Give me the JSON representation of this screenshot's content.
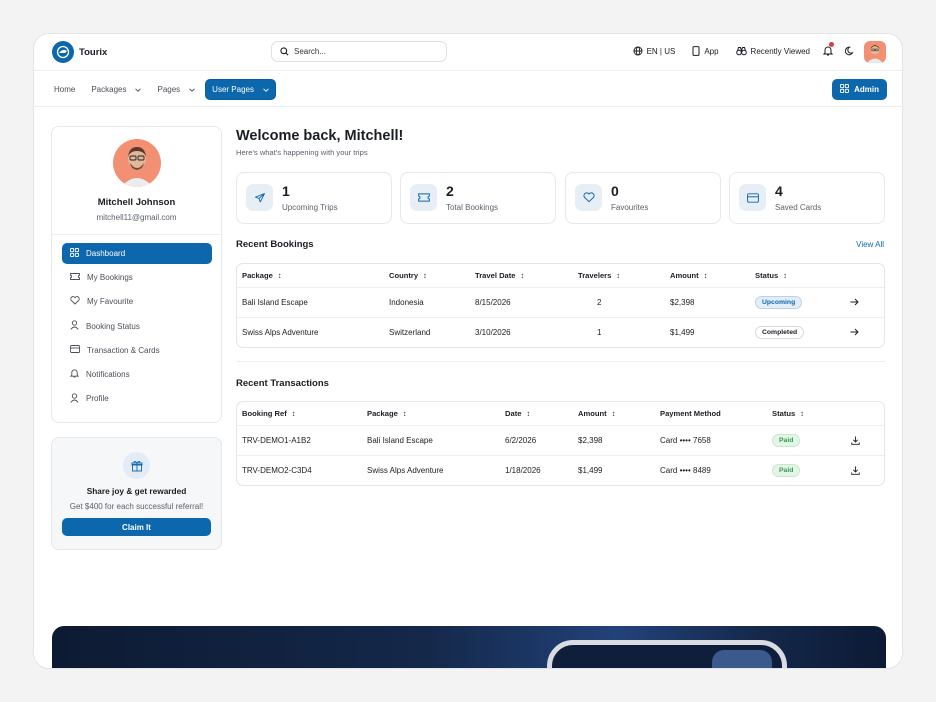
{
  "app": {
    "name": "Tourix"
  },
  "search": {
    "placeholder": "Search..."
  },
  "topbar": {
    "language": "EN | US",
    "app_label": "App",
    "recent_label": "Recently Viewed"
  },
  "nav": {
    "items": [
      {
        "label": "Home"
      },
      {
        "label": "Packages"
      },
      {
        "label": "Pages"
      },
      {
        "label": "User Pages"
      }
    ],
    "admin_label": "Admin"
  },
  "profile": {
    "name": "Mitchell Johnson",
    "email": "mitchell11@gmail.com"
  },
  "sidebar": {
    "items": [
      {
        "label": "Dashboard",
        "icon": "dashboard-icon"
      },
      {
        "label": "My Bookings",
        "icon": "ticket-icon"
      },
      {
        "label": "My Favourite",
        "icon": "heart-icon"
      },
      {
        "label": "Booking Status",
        "icon": "user-status-icon"
      },
      {
        "label": "Transaction & Cards",
        "icon": "card-icon"
      },
      {
        "label": "Notifications",
        "icon": "bell-icon"
      },
      {
        "label": "Profile",
        "icon": "user-icon"
      }
    ]
  },
  "promo": {
    "title": "Share joy & get rewarded",
    "subtitle": "Get $400 for each successful referral!",
    "button": "Claim It"
  },
  "main": {
    "welcome": "Welcome back, Mitchell!",
    "subtitle": "Here's what's happening with your trips"
  },
  "stats": [
    {
      "value": "1",
      "label": "Upcoming Trips",
      "icon": "plane-icon"
    },
    {
      "value": "2",
      "label": "Total Bookings",
      "icon": "ticket-icon"
    },
    {
      "value": "0",
      "label": "Favourites",
      "icon": "heart-icon"
    },
    {
      "value": "4",
      "label": "Saved Cards",
      "icon": "card-icon"
    }
  ],
  "bookings": {
    "title": "Recent Bookings",
    "view_all": "View All",
    "headers": [
      "Package",
      "Country",
      "Travel Date",
      "Travelers",
      "Amount",
      "Status"
    ],
    "rows": [
      {
        "package": "Bali Island Escape",
        "country": "Indonesia",
        "date": "8/15/2026",
        "travelers": "2",
        "amount": "$2,398",
        "status": "Upcoming"
      },
      {
        "package": "Swiss Alps Adventure",
        "country": "Switzerland",
        "date": "3/10/2026",
        "travelers": "1",
        "amount": "$1,499",
        "status": "Completed"
      }
    ]
  },
  "transactions": {
    "title": "Recent Transactions",
    "headers": [
      "Booking Ref",
      "Package",
      "Date",
      "Amount",
      "Payment Method",
      "Status"
    ],
    "rows": [
      {
        "ref": "TRV-DEMO1-A1B2",
        "package": "Bali Island Escape",
        "date": "6/2/2026",
        "amount": "$2,398",
        "method": "Card •••• 7658",
        "status": "Paid"
      },
      {
        "ref": "TRV-DEMO2-C3D4",
        "package": "Swiss Alps Adventure",
        "date": "1/18/2026",
        "amount": "$1,499",
        "method": "Card •••• 8489",
        "status": "Paid"
      }
    ]
  },
  "colors": {
    "accent": "#0c67ad",
    "paid": "#2f9c4a",
    "notification": "#e53935"
  }
}
